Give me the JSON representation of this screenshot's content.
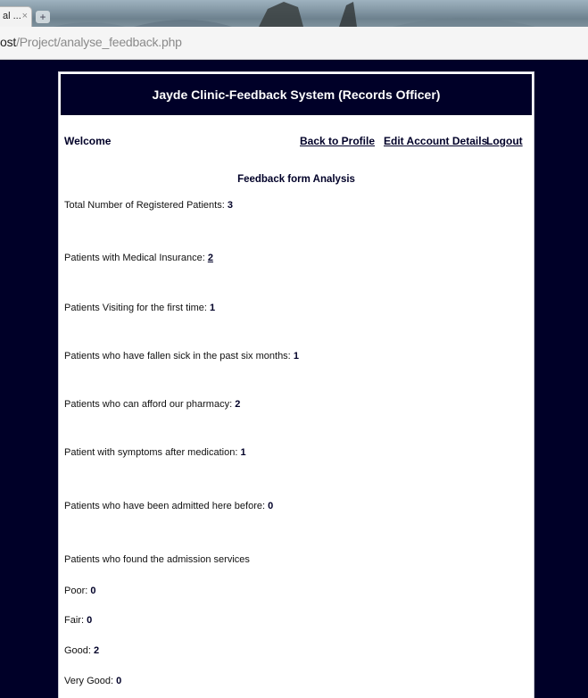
{
  "browser": {
    "tab_title": "al ...",
    "tab_close": "×",
    "new_tab": "+",
    "url_host": "ost",
    "url_path": "/Project/analyse_feedback.php"
  },
  "header": {
    "title": "Jayde Clinic-Feedback System (Records Officer)"
  },
  "nav": {
    "welcome": "Welcome",
    "back_to_profile": "Back to Profile",
    "edit_account": "Edit Account Details",
    "logout": "Logout"
  },
  "section_title": "Feedback form Analysis",
  "stats": [
    {
      "label": "Total Number of Registered Patients:",
      "value": "3"
    },
    {
      "label": "Patients with Medical Insurance:",
      "value": "2"
    },
    {
      "label": "Patients Visiting for the first time:",
      "value": "1"
    },
    {
      "label": "Patients who have fallen sick in the past six months:",
      "value": "1"
    },
    {
      "label": "Patients who can afford our pharmacy:",
      "value": "2"
    },
    {
      "label": "Patient with symptoms after medication:",
      "value": "1"
    },
    {
      "label": "Patients who have been admitted here before:",
      "value": "0"
    }
  ],
  "admission": {
    "heading": "Patients who found the admission services",
    "ratings": [
      {
        "label": "Poor:",
        "value": "0"
      },
      {
        "label": "Fair:",
        "value": "0"
      },
      {
        "label": "Good:",
        "value": "2"
      },
      {
        "label": "Very Good:",
        "value": "0"
      }
    ]
  },
  "colors": {
    "page_background": "#000028",
    "header_background": "#000028",
    "content_background": "#ffffff",
    "link_color": "#000028"
  }
}
